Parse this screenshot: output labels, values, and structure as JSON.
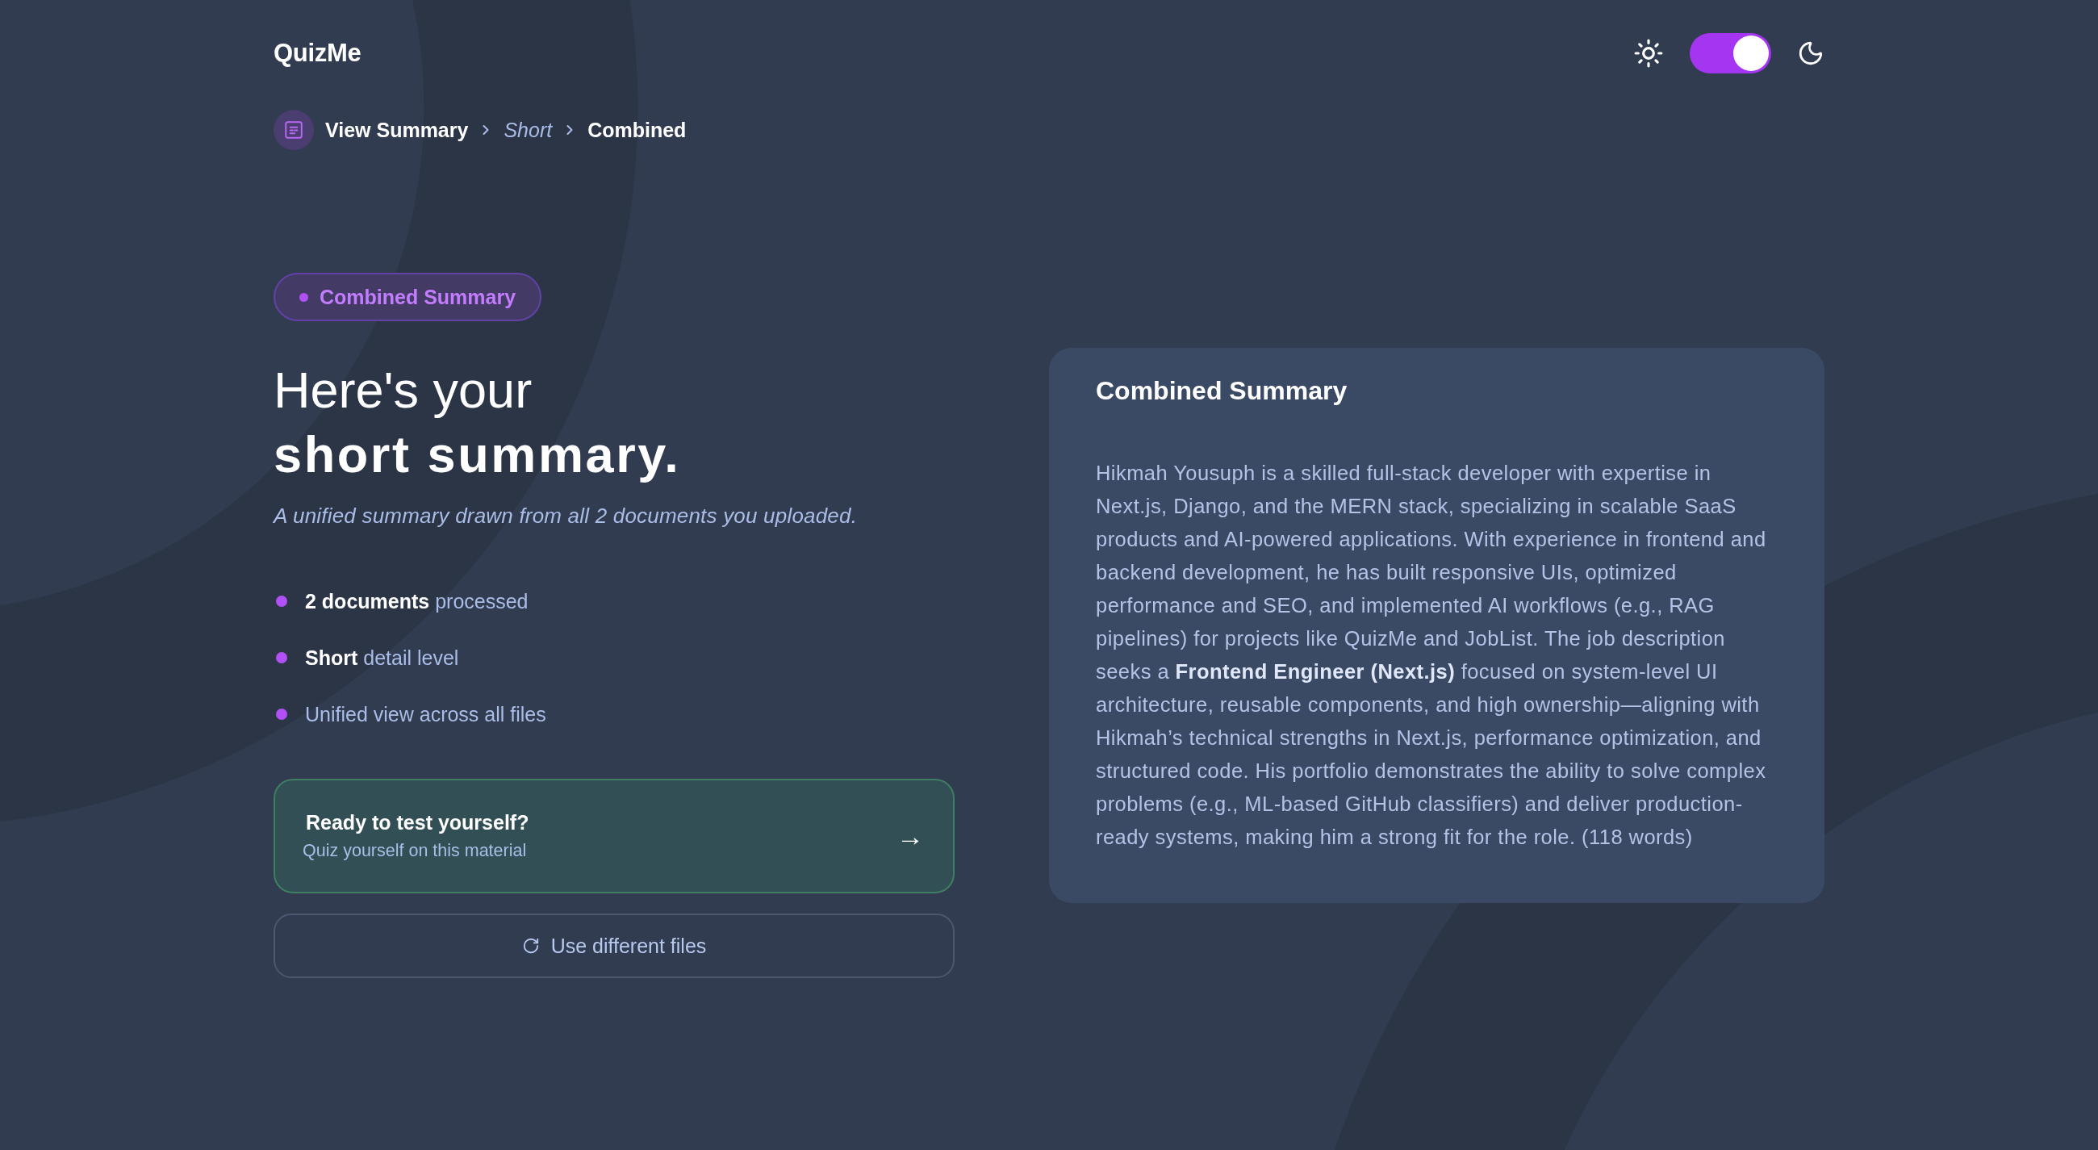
{
  "header": {
    "logo": "QuizMe",
    "theme_toggle": {
      "on": true
    }
  },
  "breadcrumb": [
    {
      "label": "View Summary",
      "kind": "link"
    },
    {
      "label": "Short",
      "kind": "detail"
    },
    {
      "label": "Combined",
      "kind": "current"
    }
  ],
  "badge": {
    "label": "Combined Summary"
  },
  "heading": {
    "line_1": "Here's your",
    "line_2": "short summary."
  },
  "subtitle": "A unified summary drawn from all 2 documents you uploaded.",
  "highlights": [
    "**2 documents** processed",
    "**Short** detail level",
    "Unified view across all files"
  ],
  "quiz_card": {
    "title": "Ready to test yourself?",
    "subtitle": "Quiz yourself on this material",
    "arrow": "→"
  },
  "secondary_button": {
    "label": "Use different files"
  },
  "summary_card": {
    "title": "Combined Summary",
    "text": "Hikmah Yousuph is a skilled full-stack developer with expertise in Next.js, Django, and the MERN stack, specializing in scalable SaaS products and AI-powered applications. With experience in frontend and backend development, he has built responsive UIs, optimized performance and SEO, and implemented AI workflows (e.g., RAG pipelines) for projects like QuizMe and JobList. The job description seeks a **Frontend Engineer (Next.js)** focused on system-level UI architecture, reusable components, and high ownership—aligning with Hikmah’s technical strengths in Next.js, performance optimization, and structured code. His portfolio demonstrates the ability to solve complex problems (e.g., ML-based GitHub classifiers) and deliver production-ready systems, making him a strong fit for the role. (118 words)"
  }
}
